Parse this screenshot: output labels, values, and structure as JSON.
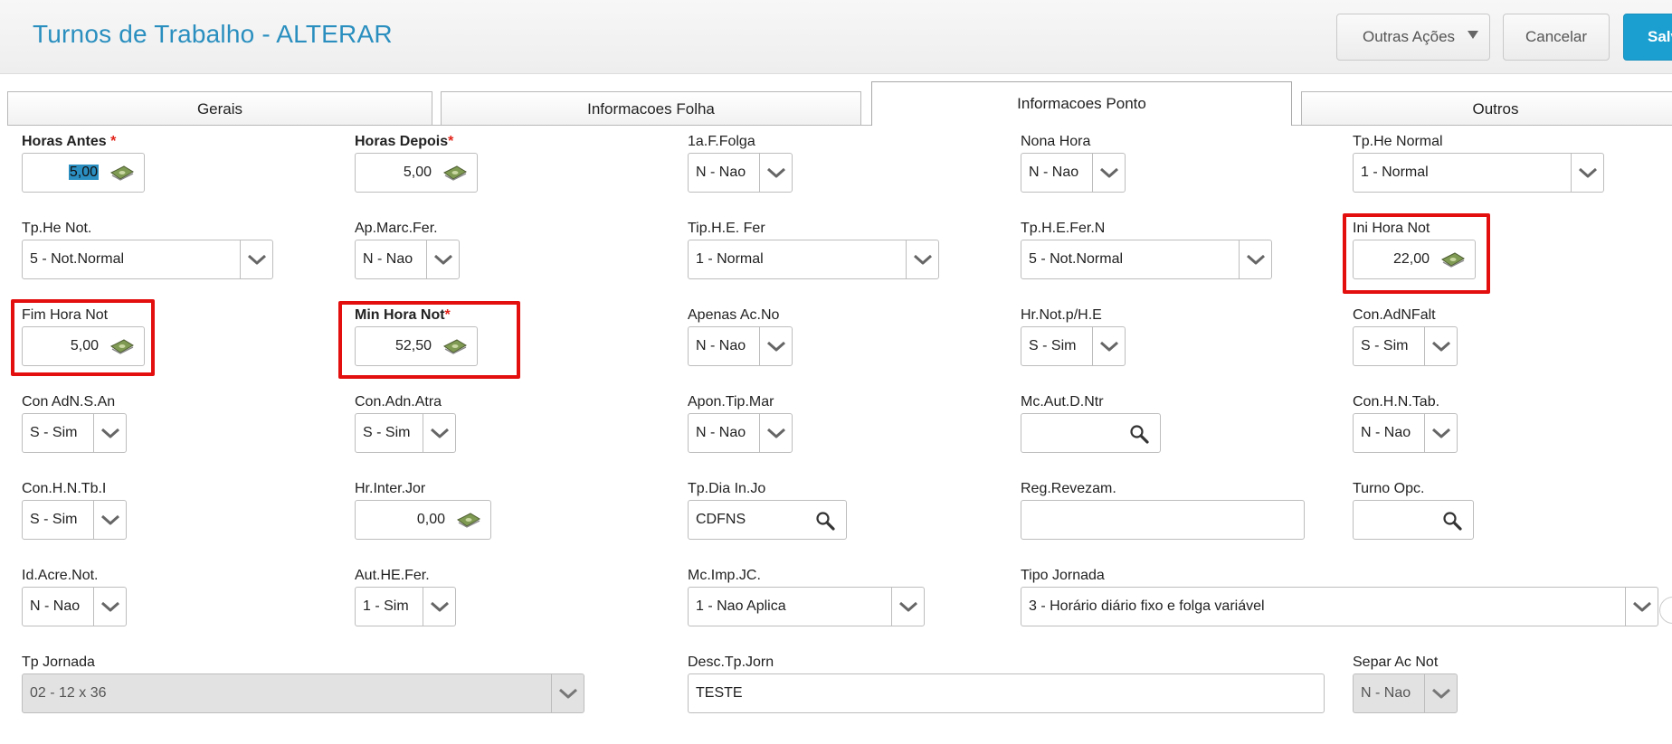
{
  "header": {
    "title": "Turnos de Trabalho - ALTERAR",
    "outras_label": "Outras Ações",
    "cancel_label": "Cancelar",
    "save_label": "Salvar"
  },
  "tabs": [
    {
      "label": "Gerais"
    },
    {
      "label": "Informacoes Folha"
    },
    {
      "label": "Informacoes Ponto"
    },
    {
      "label": "Outros"
    }
  ],
  "fields": {
    "horas_antes": {
      "label": "Horas Antes",
      "value": "5,00"
    },
    "horas_depois": {
      "label": "Horas Depois",
      "value": "5,00"
    },
    "folga": {
      "label": "1a.F.Folga",
      "value": "N - Nao"
    },
    "nona_hora": {
      "label": "Nona Hora",
      "value": "N - Nao"
    },
    "tp_he_normal": {
      "label": "Tp.He Normal",
      "value": "1 - Normal"
    },
    "tp_he_not": {
      "label": "Tp.He Not.",
      "value": "5 - Not.Normal"
    },
    "ap_marc_fer": {
      "label": "Ap.Marc.Fer.",
      "value": "N - Nao"
    },
    "tip_he_fer": {
      "label": "Tip.H.E. Fer",
      "value": "1 - Normal"
    },
    "tp_he_fer_n": {
      "label": "Tp.H.E.Fer.N",
      "value": "5 - Not.Normal"
    },
    "ini_hora_not": {
      "label": "Ini Hora Not",
      "value": "22,00"
    },
    "fim_hora_not": {
      "label": "Fim Hora Not",
      "value": "5,00"
    },
    "min_hora_not": {
      "label": "Min Hora Not",
      "value": "52,50"
    },
    "apenas_ac_no": {
      "label": "Apenas Ac.No",
      "value": "N - Nao"
    },
    "hr_not_p_he": {
      "label": "Hr.Not.p/H.E",
      "value": "S - Sim"
    },
    "con_adnfalt": {
      "label": "Con.AdNFalt",
      "value": "S - Sim"
    },
    "con_adn_s_an": {
      "label": "Con AdN.S.An",
      "value": "S - Sim"
    },
    "con_adn_atra": {
      "label": "Con.Adn.Atra",
      "value": "S - Sim"
    },
    "apon_tip_mar": {
      "label": "Apon.Tip.Mar",
      "value": "N - Nao"
    },
    "mc_aut_d_ntr": {
      "label": "Mc.Aut.D.Ntr",
      "value": ""
    },
    "con_hn_tab": {
      "label": "Con.H.N.Tab.",
      "value": "N - Nao"
    },
    "con_hn_tb_i": {
      "label": "Con.H.N.Tb.I",
      "value": "S - Sim"
    },
    "hr_inter_jor": {
      "label": "Hr.Inter.Jor",
      "value": "0,00"
    },
    "tp_dia_in_jo": {
      "label": "Tp.Dia In.Jo",
      "value": "CDFNS"
    },
    "reg_revezam": {
      "label": "Reg.Revezam.",
      "value": ""
    },
    "turno_opc": {
      "label": "Turno Opc.",
      "value": ""
    },
    "id_acre_not": {
      "label": "Id.Acre.Not.",
      "value": "N - Nao"
    },
    "aut_he_fer": {
      "label": "Aut.HE.Fer.",
      "value": "1 - Sim"
    },
    "mc_imp_jc": {
      "label": "Mc.Imp.JC.",
      "value": "1 - Nao Aplica"
    },
    "tipo_jornada": {
      "label": "Tipo Jornada",
      "value": "3 - Horário diário fixo e folga variável"
    },
    "tp_jornada": {
      "label": "Tp Jornada",
      "value": "02 - 12 x 36"
    },
    "desc_tp_jorn": {
      "label": "Desc.Tp.Jorn",
      "value": "TESTE"
    },
    "separ_ac_not": {
      "label": "Separ Ac Not",
      "value": "N - Nao"
    }
  },
  "required_mark": "*",
  "colors": {
    "accent": "#2a8fbf",
    "highlight_box": "#e30f0f",
    "save_button": "#1a9fd0"
  }
}
